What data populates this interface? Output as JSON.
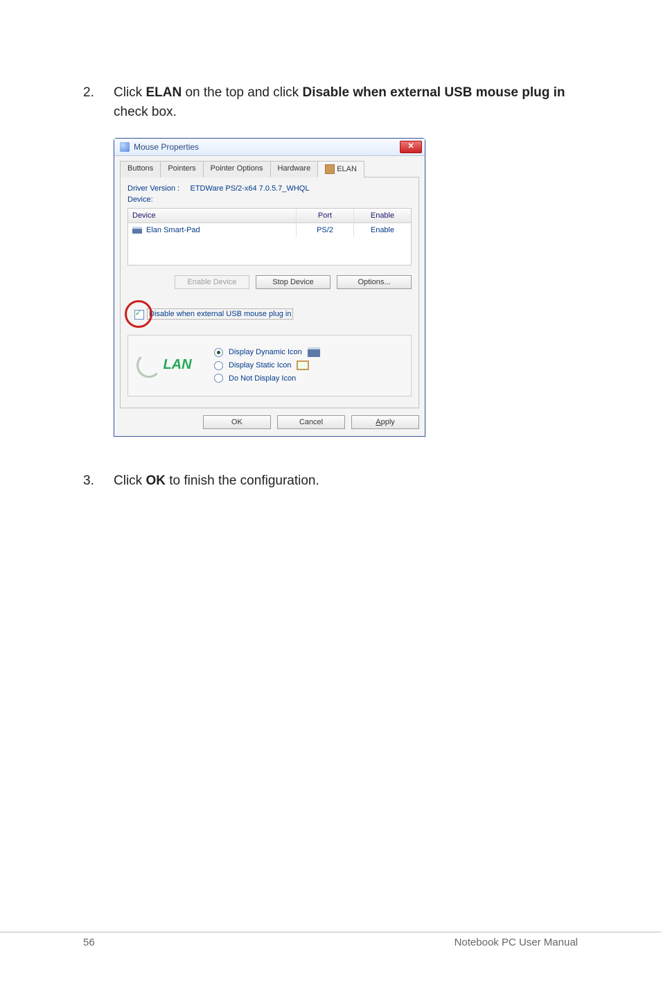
{
  "step2": {
    "num": "2.",
    "pre": "Click ",
    "b1": "ELAN",
    "mid": " on the top and click ",
    "b2": "Disable when external USB mouse plug in",
    "post": " check box."
  },
  "dialog": {
    "title": "Mouse Properties",
    "tabs": {
      "buttons": "Buttons",
      "pointers": "Pointers",
      "pointer_options": "Pointer Options",
      "hardware": "Hardware",
      "elan": "ELAN"
    },
    "driver_label": "Driver Version :",
    "driver_value": "ETDWare PS/2-x64 7.0.5.7_WHQL",
    "device_label": "Device:",
    "table": {
      "h_device": "Device",
      "h_port": "Port",
      "h_enable": "Enable",
      "row": {
        "name": "Elan Smart-Pad",
        "port": "PS/2",
        "enable": "Enable"
      }
    },
    "btn_enable": "Enable Device",
    "btn_stop": "Stop Device",
    "btn_options": "Options...",
    "check_prefix": "Di",
    "check_rest": "sable when external USB mouse plug in",
    "logo": "LAN",
    "radios": {
      "dynamic": "Display Dynamic Icon",
      "static": "Display Static Icon",
      "none": "Do Not Display Icon"
    },
    "ok": "OK",
    "cancel": "Cancel",
    "apply": "Apply",
    "apply_underline": "A"
  },
  "step3": {
    "num": "3.",
    "pre": "Click ",
    "b1": "OK",
    "post": " to finish the configuration."
  },
  "footer": {
    "page": "56",
    "title": "Notebook PC User Manual"
  }
}
